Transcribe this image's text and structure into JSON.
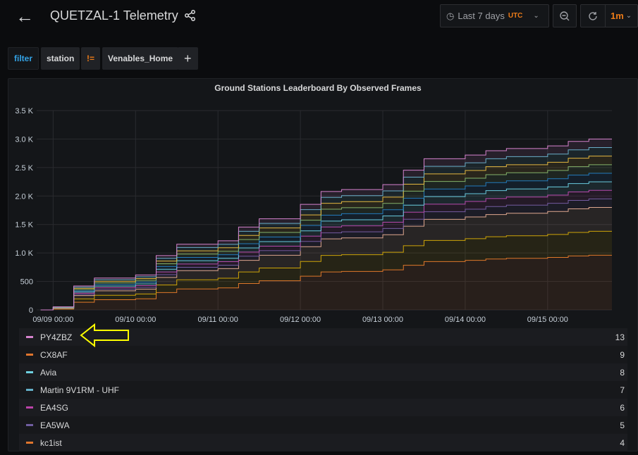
{
  "header": {
    "title": "QUETZAL-1 Telemetry",
    "time_range": "Last 7 days",
    "timezone": "UTC",
    "refresh_interval": "1m"
  },
  "filters": {
    "label": "filter",
    "key": "station",
    "operator": "!=",
    "value": "Venables_Home",
    "add": "+"
  },
  "panel": {
    "title": "Ground Stations Leaderboard By Observed Frames"
  },
  "chart_data": {
    "type": "area",
    "stacked": true,
    "title": "Ground Stations Leaderboard By Observed Frames",
    "x_unit": "days since 09/09 00:00",
    "x": [
      -0.15,
      0,
      0.25,
      0.5,
      1,
      1.25,
      1.5,
      2,
      2.25,
      2.5,
      3,
      3.25,
      3.5,
      4,
      4.25,
      4.5,
      5,
      5.25,
      5.5,
      6,
      6.25,
      6.5,
      6.78
    ],
    "xlim": [
      -0.2,
      6.78
    ],
    "x_ticks": [
      {
        "v": 0,
        "label": "09/09 00:00"
      },
      {
        "v": 1,
        "label": "09/10 00:00"
      },
      {
        "v": 2,
        "label": "09/11 00:00"
      },
      {
        "v": 3,
        "label": "09/12 00:00"
      },
      {
        "v": 4,
        "label": "09/13 00:00"
      },
      {
        "v": 5,
        "label": "09/14 00:00"
      },
      {
        "v": 6,
        "label": "09/15 00:00"
      }
    ],
    "y_ticks": [
      {
        "v": 0,
        "label": "0"
      },
      {
        "v": 500,
        "label": "500"
      },
      {
        "v": 1000,
        "label": "1.0 K"
      },
      {
        "v": 1500,
        "label": "1.5 K"
      },
      {
        "v": 2000,
        "label": "2.0 K"
      },
      {
        "v": 2500,
        "label": "2.5 K"
      },
      {
        "v": 3000,
        "label": "3.0 K"
      },
      {
        "v": 3500,
        "label": "3.5 K"
      }
    ],
    "ylim": [
      0,
      3500
    ],
    "grid": true,
    "series": [
      {
        "color": "#e0752d",
        "values": [
          0,
          16,
          134,
          179,
          195,
          304,
          368,
          387,
          464,
          512,
          592,
          666,
          675,
          704,
          784,
          848,
          870,
          893,
          906,
          922,
          947,
          960,
          960
        ]
      },
      {
        "color": "#cca300",
        "values": [
          0,
          7,
          59,
          78,
          85,
          133,
          161,
          169,
          203,
          224,
          259,
          291,
          295,
          308,
          343,
          371,
          381,
          391,
          396,
          403,
          414,
          420,
          420
        ]
      },
      {
        "color": "#e5ac8f",
        "values": [
          0,
          7,
          59,
          78,
          85,
          133,
          161,
          169,
          203,
          224,
          259,
          291,
          295,
          308,
          343,
          371,
          381,
          391,
          396,
          403,
          414,
          420,
          420
        ]
      },
      {
        "color": "#705da0",
        "values": [
          0,
          3,
          21,
          28,
          31,
          48,
          58,
          61,
          73,
          80,
          93,
          104,
          106,
          110,
          123,
          133,
          136,
          140,
          142,
          144,
          148,
          150,
          150
        ]
      },
      {
        "color": "#ba43a9",
        "values": [
          0,
          3,
          21,
          28,
          31,
          48,
          58,
          61,
          73,
          80,
          93,
          104,
          106,
          110,
          123,
          133,
          136,
          140,
          142,
          144,
          148,
          150,
          150
        ]
      },
      {
        "color": "#6ed0e0",
        "values": [
          0,
          3,
          21,
          28,
          31,
          48,
          58,
          61,
          73,
          80,
          93,
          104,
          106,
          110,
          123,
          133,
          136,
          140,
          142,
          144,
          148,
          150,
          150
        ]
      },
      {
        "color": "#1f78c1",
        "values": [
          0,
          3,
          21,
          28,
          31,
          48,
          58,
          61,
          73,
          80,
          93,
          104,
          106,
          110,
          123,
          133,
          136,
          140,
          142,
          144,
          148,
          150,
          150
        ]
      },
      {
        "color": "#7eb26d",
        "values": [
          0,
          3,
          21,
          28,
          31,
          48,
          58,
          61,
          73,
          80,
          93,
          104,
          106,
          110,
          123,
          133,
          136,
          140,
          142,
          144,
          148,
          150,
          150
        ]
      },
      {
        "color": "#eab839",
        "values": [
          0,
          3,
          21,
          28,
          31,
          48,
          58,
          61,
          73,
          80,
          93,
          104,
          106,
          110,
          123,
          133,
          136,
          140,
          142,
          144,
          148,
          150,
          150
        ]
      },
      {
        "color": "#64b0c8",
        "values": [
          0,
          3,
          21,
          28,
          31,
          48,
          58,
          61,
          73,
          80,
          93,
          104,
          106,
          110,
          123,
          133,
          136,
          140,
          142,
          144,
          148,
          150,
          150
        ]
      },
      {
        "color": "#d683ce",
        "values": [
          0,
          3,
          21,
          28,
          31,
          48,
          58,
          61,
          73,
          80,
          93,
          104,
          106,
          110,
          123,
          133,
          136,
          140,
          142,
          144,
          148,
          150,
          150
        ]
      }
    ]
  },
  "legend": [
    {
      "name": "PY4ZBZ",
      "value": "13",
      "color": "#d683ce"
    },
    {
      "name": "CX8AF",
      "value": "9",
      "color": "#e0752d"
    },
    {
      "name": "Avia",
      "value": "8",
      "color": "#6ed0e0"
    },
    {
      "name": "Martin 9V1RM - UHF",
      "value": "7",
      "color": "#64b0c8"
    },
    {
      "name": "EA4SG",
      "value": "6",
      "color": "#ba43a9"
    },
    {
      "name": "EA5WA",
      "value": "5",
      "color": "#705da0"
    },
    {
      "name": "kc1ist",
      "value": "4",
      "color": "#e0752d"
    }
  ]
}
